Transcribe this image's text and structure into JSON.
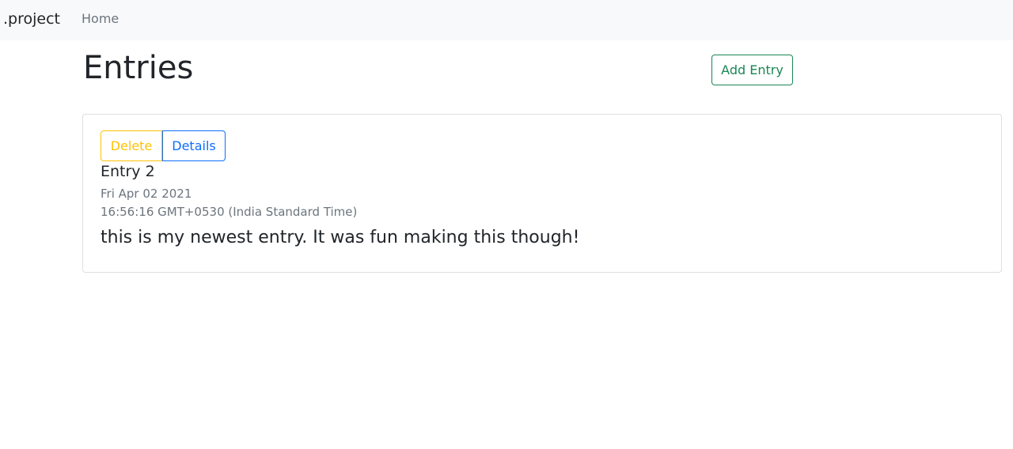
{
  "navbar": {
    "brand": ".project",
    "links": [
      "Home"
    ]
  },
  "main": {
    "title": "Entries",
    "add_button_label": "Add Entry"
  },
  "entries": [
    {
      "delete_label": "Delete",
      "details_label": "Details",
      "title": "Entry 2",
      "date": "Fri Apr 02 2021",
      "time": "16:56:16 GMT+0530 (India Standard Time)",
      "text": "this is my newest entry. It was fun making this though!"
    }
  ],
  "colors": {
    "navbar_bg": "#f8f9fa",
    "success": "#198754",
    "warning": "#ffc107",
    "primary": "#0d6efd",
    "muted": "#6c757d"
  }
}
